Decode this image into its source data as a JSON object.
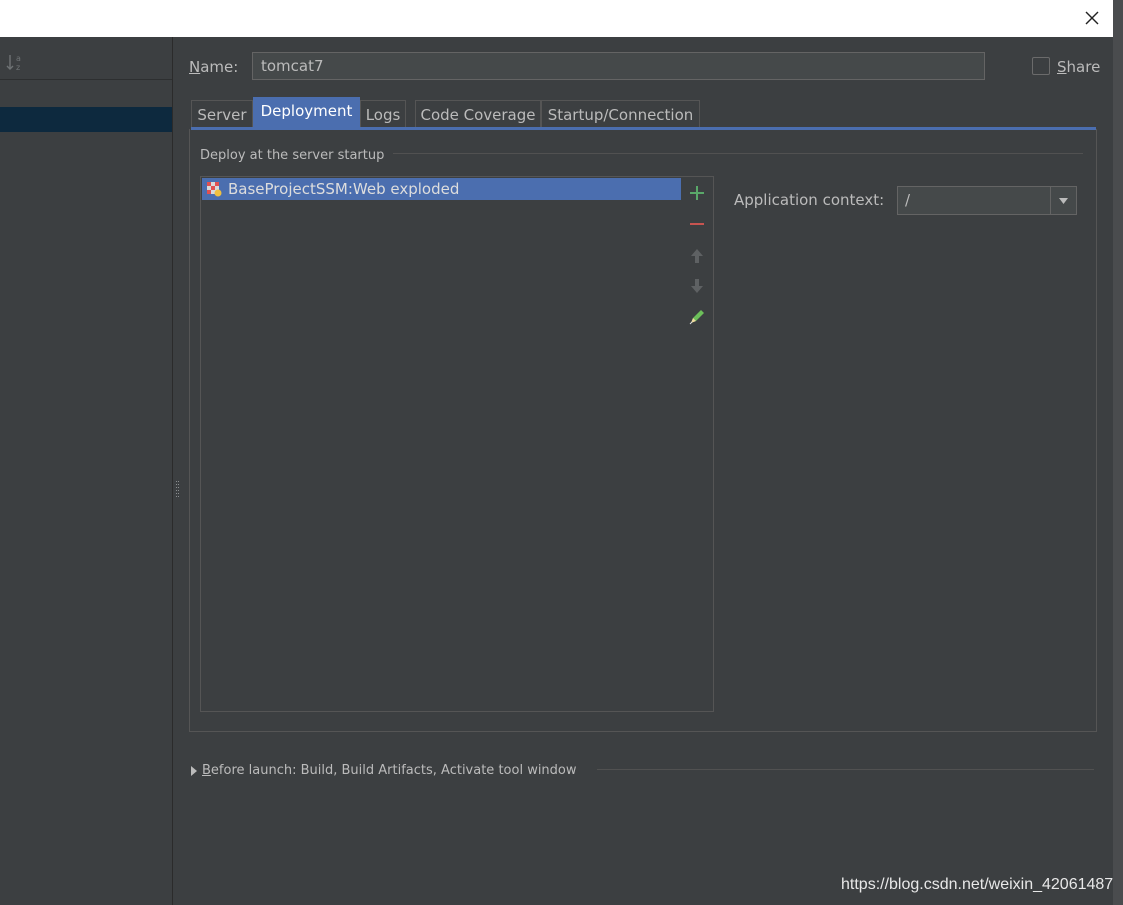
{
  "config": {
    "name_label_mnemonic": "N",
    "name_label_rest": "ame:",
    "name_value": "tomcat7",
    "share_mnemonic": "S",
    "share_rest": "hare",
    "share_checked": false
  },
  "tabs": [
    {
      "label": "Server",
      "active": false
    },
    {
      "label": "Deployment",
      "active": true
    },
    {
      "label": "Logs",
      "active": false
    },
    {
      "label": "Code Coverage",
      "active": false
    },
    {
      "label": "Startup/Connection",
      "active": false
    }
  ],
  "deployment": {
    "group_title": "Deploy at the server startup",
    "artifacts": [
      {
        "label": "BaseProjectSSM:Web exploded",
        "icon": "web-artifact-icon",
        "selected": true
      }
    ],
    "toolbar": [
      "add-icon",
      "remove-icon",
      "move-up-icon",
      "move-down-icon",
      "edit-icon"
    ],
    "context_label": "Application context:",
    "context_value": "/"
  },
  "before_launch": {
    "mnemonic": "B",
    "rest": "efore launch: Build, Build Artifacts, Activate tool window"
  },
  "watermark": "https://blog.csdn.net/weixin_42061487",
  "colors": {
    "background": "#3c3f41",
    "selection": "#4b6eaf",
    "tree_selection": "#0d293e",
    "add_green": "#59a869",
    "remove_red": "#c75450"
  }
}
